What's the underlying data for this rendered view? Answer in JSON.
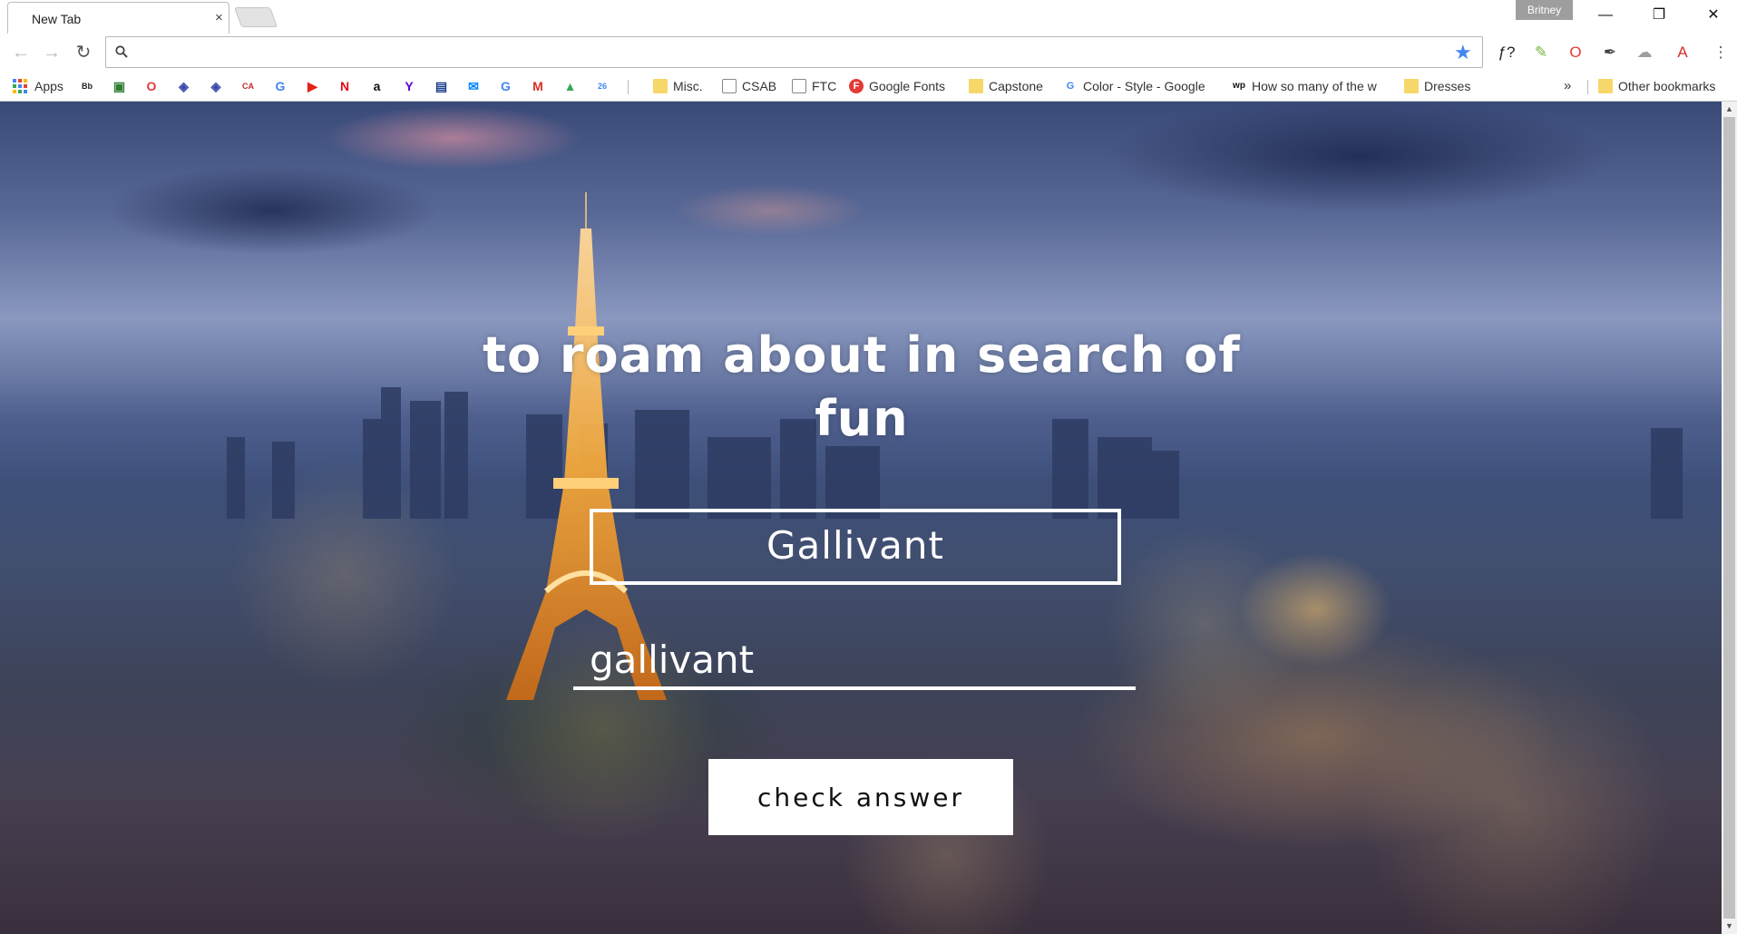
{
  "window": {
    "tab_title": "New Tab",
    "tab_close": "×",
    "profile_name": "Britney",
    "minimize": "—",
    "restore": "❐",
    "close": "✕"
  },
  "toolbar": {
    "back": "←",
    "forward": "→",
    "reload": "↻",
    "omnibox_value": "",
    "star": "★",
    "extensions": [
      {
        "name": "font-finder-ext-icon",
        "glyph": "ƒ?",
        "color": "#222"
      },
      {
        "name": "leaf-ext-icon",
        "glyph": "✎",
        "color": "#7cb342"
      },
      {
        "name": "opera-ext-icon",
        "glyph": "O",
        "color": "#e53935"
      },
      {
        "name": "eyedropper-ext-icon",
        "glyph": "✒",
        "color": "#444"
      },
      {
        "name": "cloud-ext-icon",
        "glyph": "☁",
        "color": "#9e9e9e"
      },
      {
        "name": "acrobat-ext-icon",
        "glyph": "A",
        "color": "#d32f2f"
      }
    ],
    "menu": "⋮"
  },
  "bookmarks": {
    "apps_label": "Apps",
    "icon_items": [
      {
        "name": "blackboard-bookmark-icon",
        "glyph": "Bb",
        "color": "#222"
      },
      {
        "name": "classroom-bookmark-icon",
        "glyph": "▣",
        "color": "#2e7d32"
      },
      {
        "name": "opera-bookmark-icon",
        "glyph": "O",
        "color": "#e53935"
      },
      {
        "name": "diamond-bookmark-icon-1",
        "glyph": "◈",
        "color": "#3949ab"
      },
      {
        "name": "diamond-bookmark-icon-2",
        "glyph": "◈",
        "color": "#3949ab"
      },
      {
        "name": "ca-bookmark-icon",
        "glyph": "CA",
        "color": "#c62828"
      },
      {
        "name": "translate-bookmark-icon",
        "glyph": "G",
        "color": "#4285f4"
      },
      {
        "name": "youtube-bookmark-icon",
        "glyph": "▶",
        "color": "#e62117"
      },
      {
        "name": "netflix-bookmark-icon",
        "glyph": "N",
        "color": "#e50914"
      },
      {
        "name": "amazon-bookmark-icon",
        "glyph": "a",
        "color": "#111"
      },
      {
        "name": "yahoo-bookmark-icon",
        "glyph": "Y",
        "color": "#5f01d1"
      },
      {
        "name": "news-bookmark-icon",
        "glyph": "▤",
        "color": "#1a3c8c"
      },
      {
        "name": "messenger-bookmark-icon",
        "glyph": "✉",
        "color": "#0084ff"
      },
      {
        "name": "google-bookmark-icon",
        "glyph": "G",
        "color": "#4285f4"
      },
      {
        "name": "gmail-bookmark-icon",
        "glyph": "M",
        "color": "#d93025"
      },
      {
        "name": "drive-bookmark-icon",
        "glyph": "▲",
        "color": "#34a853"
      },
      {
        "name": "calendar-bookmark-icon",
        "glyph": "26",
        "color": "#4285f4"
      }
    ],
    "items": [
      {
        "label": "Misc.",
        "type": "folder"
      },
      {
        "label": "CSAB",
        "type": "page"
      },
      {
        "label": "FTC",
        "type": "page"
      },
      {
        "label": "Google Fonts",
        "type": "fonts"
      },
      {
        "label": "Capstone",
        "type": "folder"
      },
      {
        "label": "Color - Style - Google",
        "type": "google"
      },
      {
        "label": "How so many of the w",
        "type": "wp"
      },
      {
        "label": "Dresses",
        "type": "folder"
      }
    ],
    "overflow": "»",
    "other_label": "Other bookmarks"
  },
  "page": {
    "definition": "to roam about in search of fun",
    "word": "Gallivant",
    "answer_value": "gallivant",
    "check_label": "check answer"
  },
  "colors": {
    "star": "#4285f4",
    "folder": "#f6d86a"
  }
}
